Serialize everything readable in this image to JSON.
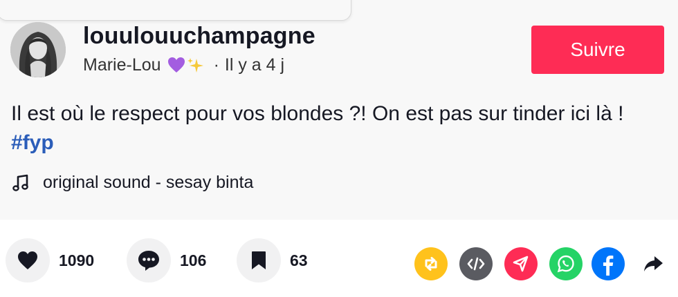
{
  "author": {
    "username": "louulouuchampagne",
    "display_name": "Marie-Lou",
    "name_emoji": "💜✨",
    "separator": "·",
    "posted_ago": "Il y a 4 j"
  },
  "follow_button": {
    "label": "Suivre"
  },
  "caption": {
    "text": "Il est où le respect pour vos blondes ?! On est pas sur tinder ici là ! ",
    "hashtag": "#fyp"
  },
  "sound": {
    "icon": "music-note-icon",
    "label": "original sound - sesay binta"
  },
  "stats": {
    "likes": "1090",
    "comments": "106",
    "favorites": "63"
  },
  "share_buttons": [
    {
      "icon": "repost-icon",
      "color": "#ffc21c"
    },
    {
      "icon": "embed-icon",
      "color": "#5a5b61"
    },
    {
      "icon": "send-icon",
      "color": "#fe2c55"
    },
    {
      "icon": "whatsapp-icon",
      "color": "#25d366"
    },
    {
      "icon": "facebook-icon",
      "color": "#0075fa"
    },
    {
      "icon": "share-arrow-icon",
      "color": "#161823"
    }
  ],
  "colors": {
    "accent": "#fe2c55",
    "hashtag": "#2b5db9",
    "panel": "#f8f8f8"
  }
}
